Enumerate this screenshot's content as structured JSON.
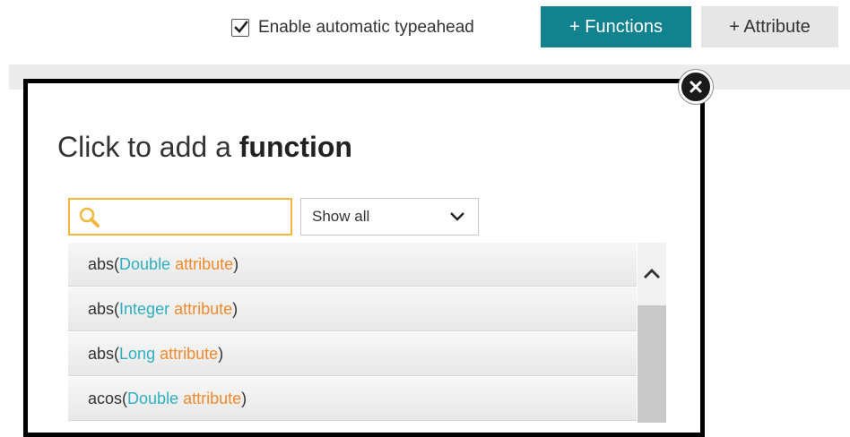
{
  "toolbar": {
    "typeahead_label": "Enable automatic typeahead",
    "typeahead_checked": true,
    "functions_button": "+ Functions",
    "attribute_button": "+ Attribute",
    "accent_color": "#13828f"
  },
  "dialog": {
    "title_prefix": "Click to add a ",
    "title_bold": "function",
    "search_placeholder": "",
    "filter_selected": "Show all",
    "close_icon": "close-icon"
  },
  "functions": [
    {
      "name": "abs",
      "type": "Double",
      "param": "attribute"
    },
    {
      "name": "abs",
      "type": "Integer",
      "param": "attribute"
    },
    {
      "name": "abs",
      "type": "Long",
      "param": "attribute"
    },
    {
      "name": "acos",
      "type": "Double",
      "param": "attribute"
    }
  ],
  "colors": {
    "type": "#2fb0c0",
    "param": "#f08a2d",
    "search_border": "#f3b73e"
  }
}
